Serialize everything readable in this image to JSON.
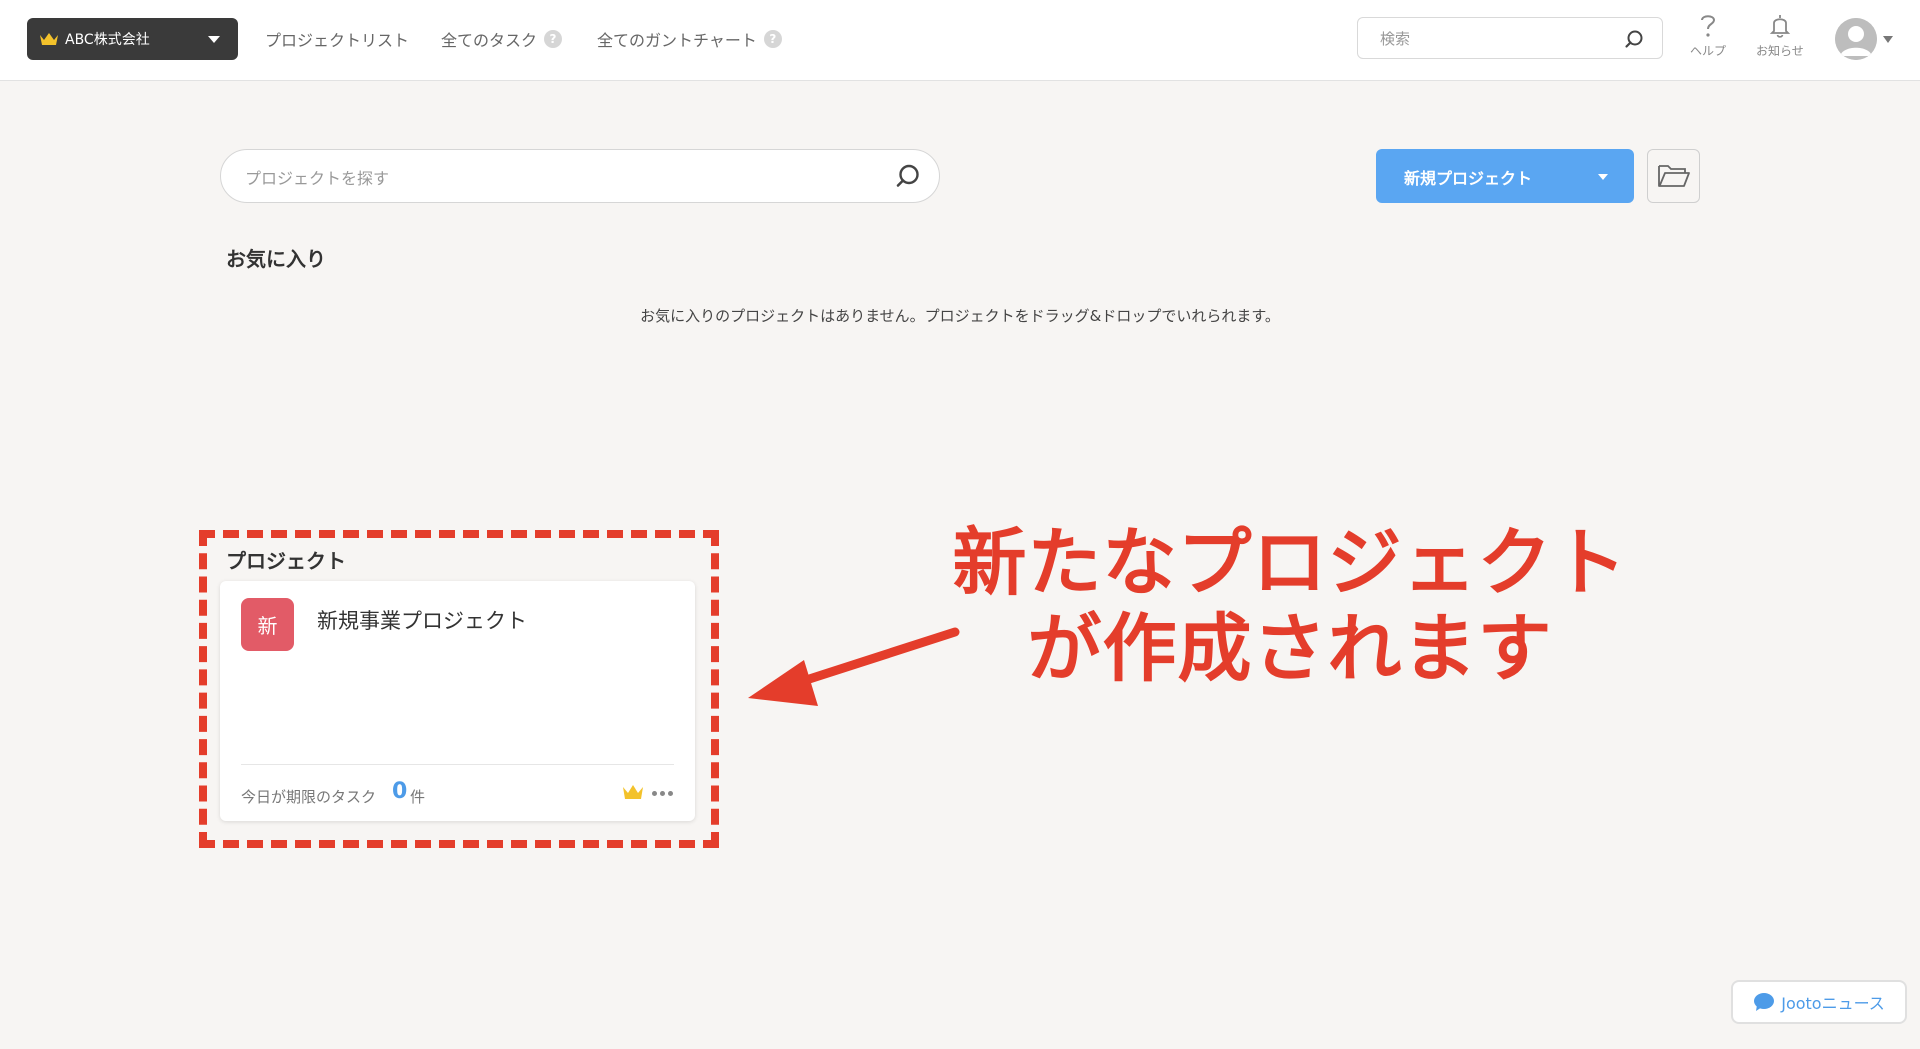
{
  "header": {
    "org_name": "ABC株式会社",
    "nav": {
      "project_list": "プロジェクトリスト",
      "all_tasks": "全てのタスク",
      "all_gantt": "全てのガントチャート",
      "help_badge": "?"
    },
    "search_placeholder": "検索",
    "help_label": "ヘルプ",
    "notifications_label": "お知らせ"
  },
  "main": {
    "project_search_placeholder": "プロジェクトを探す",
    "new_project_label": "新規プロジェクト",
    "favorites_title": "お気に入り",
    "favorites_empty": "お気に入りのプロジェクトはありません。プロジェクトをドラッグ&ドロップでいれられます。",
    "projects_title": "プロジェクト",
    "projects": [
      {
        "icon_char": "新",
        "icon_color": "#e25b67",
        "name": "新規事業プロジェクト",
        "due_today_label": "今日が期限のタスク",
        "due_today_count": "0",
        "due_today_unit": "件"
      }
    ]
  },
  "annotation": {
    "line1": "新たなプロジェクト",
    "line2": "が作成されます",
    "color": "#e43d2b"
  },
  "news_button": "Jootoニュース",
  "colors": {
    "accent": "#5aa6f2",
    "header_org_bg": "#3a3a3a",
    "background": "#f7f5f3"
  }
}
